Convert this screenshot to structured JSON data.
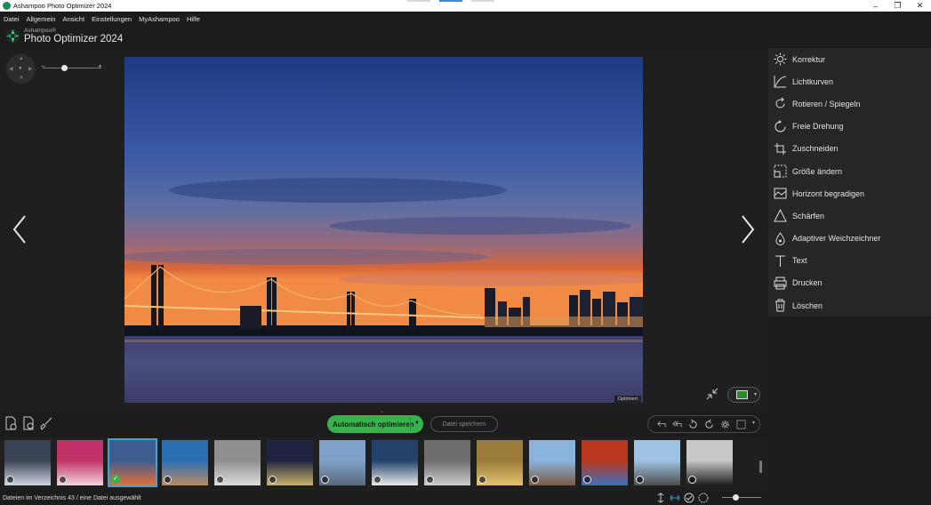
{
  "window": {
    "title": "Ashampoo Photo Optimizer 2024",
    "controls": [
      "–",
      "❐",
      "✕"
    ]
  },
  "menu": [
    "Datei",
    "Allgemein",
    "Ansicht",
    "Einstellungen",
    "MyAshampoo",
    "Hilfe"
  ],
  "brand": {
    "small": "Ashampoo®",
    "name": "Photo Optimizer 2024"
  },
  "viewer": {
    "zoom_level": 0.37,
    "minus": "−",
    "plus": "+",
    "badge": "Optimiert"
  },
  "tools": [
    {
      "label": "Korrektur",
      "icon": "sun-icon"
    },
    {
      "label": "Lichtkurven",
      "icon": "curve-icon"
    },
    {
      "label": "Rotieren / Spiegeln",
      "icon": "rotate-icon"
    },
    {
      "label": "Freie Drehung",
      "icon": "free-rotate-icon"
    },
    {
      "label": "Zuschneiden",
      "icon": "crop-icon"
    },
    {
      "label": "Größe ändern",
      "icon": "resize-icon"
    },
    {
      "label": "Horizont begradigen",
      "icon": "horizon-icon"
    },
    {
      "label": "Schärfen",
      "icon": "sharpen-icon"
    },
    {
      "label": "Adaptiver Weichzeichner",
      "icon": "drop-icon"
    },
    {
      "label": "Text",
      "icon": "text-icon"
    },
    {
      "label": "Drucken",
      "icon": "print-icon"
    },
    {
      "label": "Löschen",
      "icon": "delete-icon"
    }
  ],
  "toolbar": {
    "auto_optimize": "Automatisch optimieren",
    "save_file": "Datei speichern"
  },
  "thumbnails": [
    {
      "colors": [
        "#3a4255",
        "#cfd6e0"
      ],
      "selected": false,
      "checked": false
    },
    {
      "colors": [
        "#c2326a",
        "#f2d3dc"
      ],
      "selected": false,
      "checked": false
    },
    {
      "colors": [
        "#3e5c8f",
        "#e36f3a"
      ],
      "selected": true,
      "checked": true
    },
    {
      "colors": [
        "#2b6fb3",
        "#b98a63"
      ],
      "selected": false,
      "checked": false
    },
    {
      "colors": [
        "#8f8f8f",
        "#dedede"
      ],
      "selected": false,
      "checked": false
    },
    {
      "colors": [
        "#1e2340",
        "#c9b46a"
      ],
      "selected": false,
      "checked": false
    },
    {
      "colors": [
        "#7ea0c9",
        "#5b6a7a"
      ],
      "selected": false,
      "checked": false
    },
    {
      "colors": [
        "#23436b",
        "#eaeaea"
      ],
      "selected": false,
      "checked": false
    },
    {
      "colors": [
        "#6d6d6d",
        "#cfcfcf"
      ],
      "selected": false,
      "checked": false
    },
    {
      "colors": [
        "#9a7b3a",
        "#e3c36c"
      ],
      "selected": false,
      "checked": false
    },
    {
      "colors": [
        "#8ab4dd",
        "#7a5c45"
      ],
      "selected": false,
      "checked": false
    },
    {
      "colors": [
        "#b8371e",
        "#3e6fbe"
      ],
      "selected": false,
      "checked": false
    },
    {
      "colors": [
        "#9fc3e3",
        "#4d4d4d"
      ],
      "selected": false,
      "checked": false
    },
    {
      "colors": [
        "#c8c8c8",
        "#1e1e1e"
      ],
      "selected": false,
      "checked": false
    }
  ],
  "status": {
    "text": "Dateien im Verzeichnis 43 / eine Datei ausgewählt",
    "zoom_level": 0.35
  },
  "colors": {
    "accent_green": "#37b24d",
    "select_blue": "#3fa4d4"
  }
}
